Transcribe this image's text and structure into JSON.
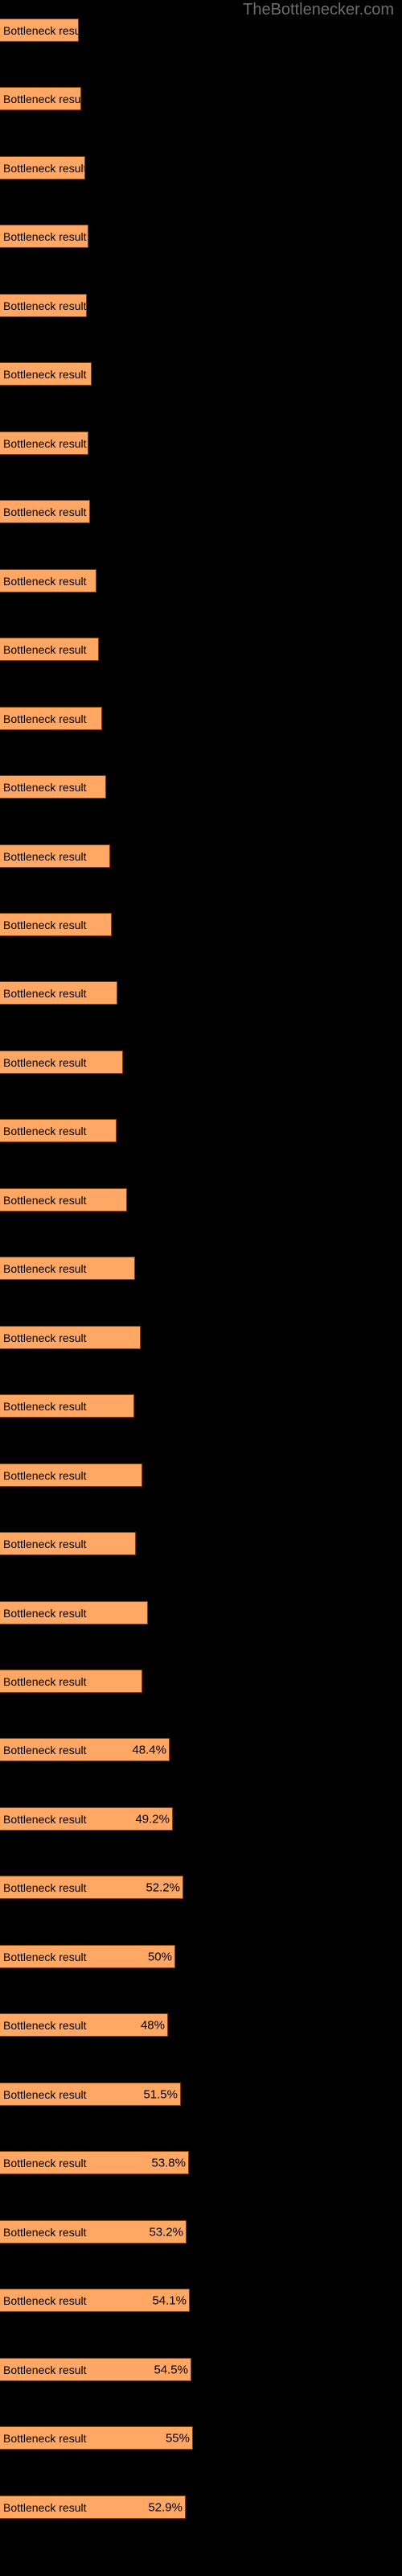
{
  "header": {
    "site_title": "TheBottlenecker.com",
    "title_color": "#6e6e6e"
  },
  "style": {
    "background": "#000000",
    "bar_fill": "#ffa866",
    "bar_border": "#804000",
    "label_color": "#000000"
  },
  "chart_data": {
    "type": "bar",
    "orientation": "horizontal",
    "title": "TheBottlenecker.com",
    "xlabel": "",
    "ylabel": "",
    "grid": false,
    "legend": false,
    "xlim": [
      0,
      100
    ],
    "bar_label_text": "Bottleneck result",
    "categories": [
      "Bottleneck result",
      "Bottleneck result",
      "Bottleneck result",
      "Bottleneck result",
      "Bottleneck result",
      "Bottleneck result",
      "Bottleneck result",
      "Bottleneck result",
      "Bottleneck result",
      "Bottleneck result",
      "Bottleneck result",
      "Bottleneck result",
      "Bottleneck result",
      "Bottleneck result",
      "Bottleneck result",
      "Bottleneck result",
      "Bottleneck result",
      "Bottleneck result",
      "Bottleneck result",
      "Bottleneck result",
      "Bottleneck result",
      "Bottleneck result",
      "Bottleneck result",
      "Bottleneck result",
      "Bottleneck result",
      "Bottleneck result",
      "Bottleneck result",
      "Bottleneck result",
      "Bottleneck result",
      "Bottleneck result",
      "Bottleneck result",
      "Bottleneck result",
      "Bottleneck result",
      "Bottleneck result",
      "Bottleneck result",
      "Bottleneck result"
    ],
    "values": [
      22.5,
      23.1,
      24.2,
      25.1,
      24.7,
      26.1,
      25.3,
      25.7,
      27.4,
      28.2,
      29.1,
      30.2,
      31.4,
      31.9,
      33.5,
      35.1,
      33.2,
      36.3,
      38.4,
      40.0,
      38.2,
      40.6,
      38.7,
      42.1,
      40.6,
      48.4,
      49.2,
      52.2,
      50.0,
      48.0,
      51.5,
      53.8,
      53.2,
      54.1,
      54.5,
      55.0
    ],
    "value_labels": [
      "",
      "",
      "",
      "",
      "",
      "",
      "",
      "",
      "",
      "",
      "",
      "",
      "",
      "",
      "",
      "",
      "",
      "",
      "",
      "",
      "",
      "",
      "",
      "",
      "",
      "48.4%",
      "49.2%",
      "52.2%",
      "50%",
      "48%",
      "51.5%",
      "53.8%",
      "53.2%",
      "54.1%",
      "54.5%",
      "55%"
    ],
    "last_row": {
      "label": "Bottleneck result",
      "value": 52.9,
      "value_label": "52.9%"
    }
  },
  "bars": [
    {
      "label": "Bottleneck result",
      "value_label": "",
      "width": 105,
      "top": 23
    },
    {
      "label": "Bottleneck result",
      "value_label": "",
      "width": 107,
      "top": 66
    },
    {
      "label": "Bottleneck result",
      "value_label": "",
      "width": 111,
      "top": 109
    },
    {
      "label": "Bottleneck result",
      "value_label": "",
      "width": 115,
      "top": 152
    },
    {
      "label": "Bottleneck result",
      "value_label": "",
      "width": 113,
      "top": 196
    },
    {
      "label": "Bottleneck result",
      "value_label": "",
      "width": 119,
      "top": 239
    },
    {
      "label": "Bottleneck result",
      "value_label": "",
      "width": 116,
      "top": 282
    },
    {
      "label": "Bottleneck result",
      "value_label": "",
      "width": 115,
      "top": 326
    },
    {
      "label": "Bottleneck result",
      "value_label": "",
      "width": 120,
      "top": 369
    },
    {
      "label": "Bottleneck result",
      "value_label": "",
      "width": 121,
      "top": 412
    },
    {
      "label": "Bottleneck result",
      "value_label": "",
      "width": 126,
      "top": 456
    },
    {
      "label": "Bottleneck result",
      "value_label": "",
      "width": 135,
      "top": 499
    },
    {
      "label": "Bottleneck result",
      "value_label": "",
      "width": 130,
      "top": 542
    },
    {
      "label": "Bottleneck result",
      "value_label": "",
      "width": 136,
      "top": 586
    },
    {
      "label": "Bottleneck result",
      "value_label": "",
      "width": 80,
      "top": 629
    },
    {
      "label": "Bottleneck result",
      "value_label": "",
      "width": 96,
      "top": 672
    },
    {
      "label": "Bottleneck result",
      "value_label": "",
      "width": 87,
      "top": 716
    },
    {
      "label": "Bottleneck result",
      "value_label": "",
      "width": 100,
      "top": 759
    },
    {
      "label": "Bottleneck result",
      "value_label": "",
      "width": 110,
      "top": 802
    },
    {
      "label": "Bottleneck result",
      "value_label": "",
      "width": 99,
      "top": 846
    },
    {
      "label": "Bottleneck result",
      "value_label": "",
      "width": 104,
      "top": 889
    },
    {
      "label": "Bottleneck result",
      "value_label": "",
      "width": 93,
      "top": 932
    },
    {
      "label": "Bottleneck result",
      "value_label": "",
      "width": 113,
      "top": 976
    },
    {
      "label": "Bottleneck result",
      "value_label": "",
      "width": 97,
      "top": 1019
    },
    {
      "label": "Bottleneck result",
      "value_label": "48.4%",
      "width": 124,
      "top": 1062
    },
    {
      "label": "Bottleneck result",
      "value_label": "49.2%",
      "width": 133,
      "top": 1106
    }
  ]
}
